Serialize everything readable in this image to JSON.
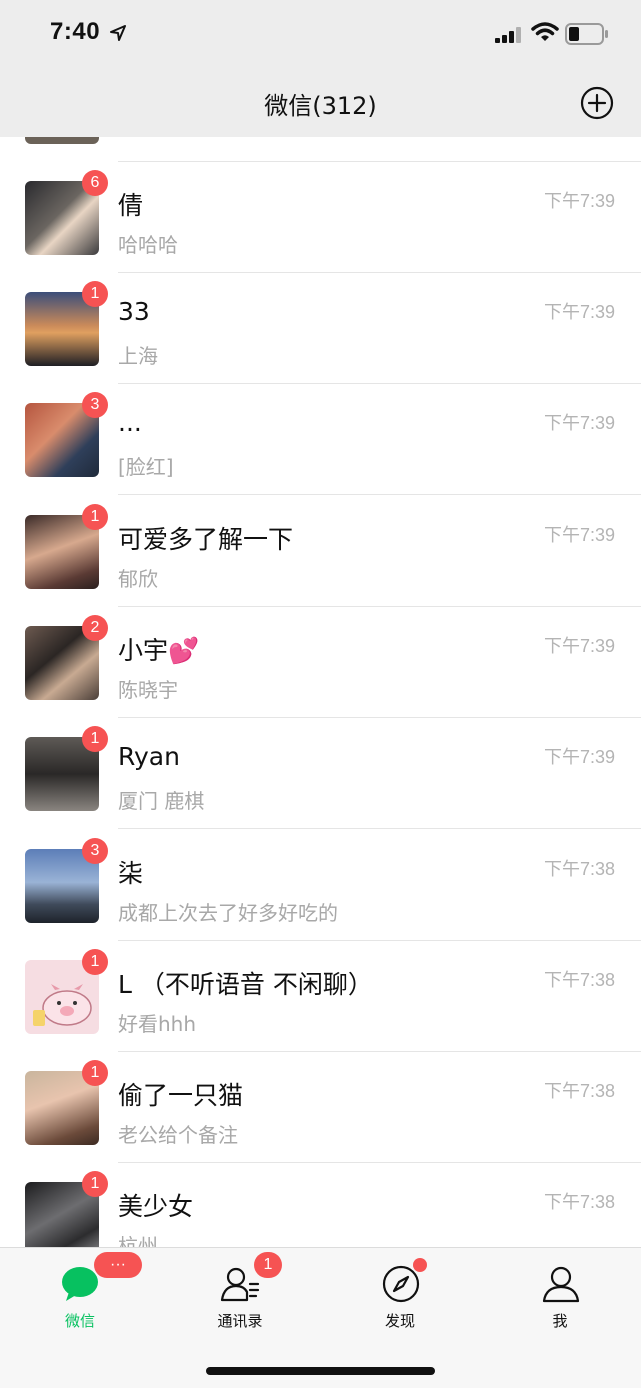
{
  "status_bar": {
    "time": "7:40"
  },
  "header": {
    "title": "微信(312)",
    "add_icon": "plus-circle-icon"
  },
  "chats": [
    {
      "name": "倩",
      "preview": "哈哈哈",
      "time": "下午7:39",
      "badge": "6"
    },
    {
      "name": "33",
      "preview": "上海",
      "time": "下午7:39",
      "badge": "1"
    },
    {
      "name": "...",
      "preview": "[脸红]",
      "time": "下午7:39",
      "badge": "3"
    },
    {
      "name": "可爱多了解一下",
      "preview": "郁欣",
      "time": "下午7:39",
      "badge": "1"
    },
    {
      "name": "小宇💕",
      "preview": "陈晓宇",
      "time": "下午7:39",
      "badge": "2"
    },
    {
      "name": "Ryan",
      "preview": "厦门  鹿棋",
      "time": "下午7:39",
      "badge": "1"
    },
    {
      "name": "柒",
      "preview": "成都上次去了好多好吃的",
      "time": "下午7:38",
      "badge": "3"
    },
    {
      "name": "L （不听语音 不闲聊）",
      "preview": "好看hhh",
      "time": "下午7:38",
      "badge": "1"
    },
    {
      "name": "偷了一只猫",
      "preview": "老公给个备注",
      "time": "下午7:38",
      "badge": "1"
    },
    {
      "name": "美少女",
      "preview": "杭州",
      "time": "下午7:38",
      "badge": "1"
    }
  ],
  "tabbar": {
    "tabs": [
      {
        "label": "微信",
        "icon": "chat-bubble-icon",
        "active": true,
        "badge": "···"
      },
      {
        "label": "通讯录",
        "icon": "contacts-icon",
        "badge": "1"
      },
      {
        "label": "发现",
        "icon": "compass-icon",
        "dot": true
      },
      {
        "label": "我",
        "icon": "person-icon"
      }
    ]
  },
  "colors": {
    "accent": "#07c160",
    "badge": "#f65353",
    "header_bg": "#ededed"
  }
}
